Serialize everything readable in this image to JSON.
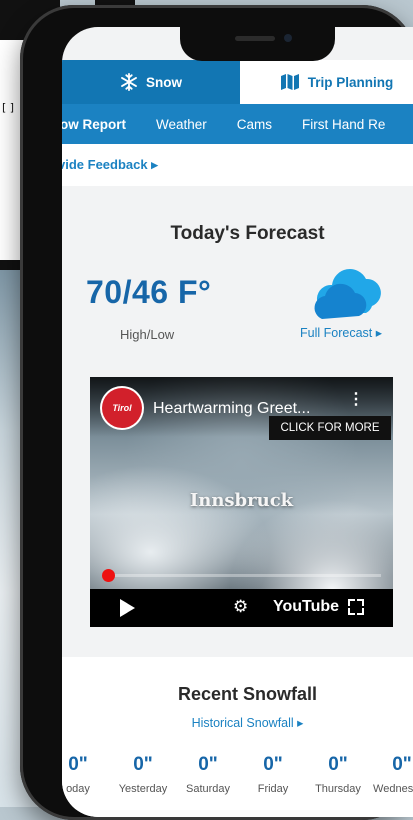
{
  "tabs": {
    "snow": "Snow",
    "trip_planning": "Trip Planning",
    "snow_icon": "snowflake-icon",
    "trip_icon": "map-icon"
  },
  "subnav": [
    "ow Report",
    "Weather",
    "Cams",
    "First Hand Re"
  ],
  "feedback": "vide Feedback ▸",
  "forecast": {
    "title": "Today's Forecast",
    "temp": "70/46 F°",
    "high_low": "High/Low",
    "link": "Full Forecast ▸",
    "icon": "cloud-icon"
  },
  "video": {
    "title": "Heartwarming Greet...",
    "more": "⋮",
    "click_more": "CLICK FOR MORE",
    "channel": "Tirol",
    "overlay_text": "Innsbruck",
    "youtube": "YouTube",
    "progress": 0.0
  },
  "snowfall": {
    "title": "Recent Snowfall",
    "link": "Historical Snowfall ▸",
    "days": [
      {
        "value": "0\"",
        "label": "oday"
      },
      {
        "value": "0\"",
        "label": "Yesterday"
      },
      {
        "value": "0\"",
        "label": "Saturday"
      },
      {
        "value": "0\"",
        "label": "Friday"
      },
      {
        "value": "0\"",
        "label": "Thursday"
      },
      {
        "value": "0\"",
        "label": "Wednesday"
      }
    ]
  },
  "colors": {
    "accent": "#1276b3",
    "link": "#1b82c2",
    "temp": "#1766a8"
  }
}
